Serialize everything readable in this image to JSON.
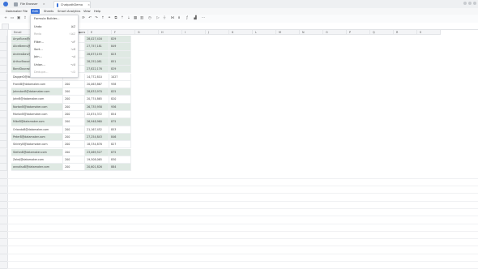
{
  "titlebar": {
    "tabs": [
      {
        "label": "File Browser"
      },
      {
        "label": "ChatpathDemo"
      }
    ]
  },
  "menubar": {
    "items": [
      "Datamaker",
      "File",
      "Edit",
      "Sheets",
      "Smart Analytics",
      "View",
      "Help"
    ],
    "active": "Edit"
  },
  "edit_menu": {
    "header": "Formula Builder...",
    "items": [
      {
        "label": "Undo",
        "shortcut": "⌘Z",
        "disabled": false
      },
      {
        "label": "Redo",
        "shortcut": "⇧⌘Z",
        "disabled": true
      },
      {
        "label": "Filter...",
        "shortcut": "⌥F",
        "disabled": false
      },
      {
        "label": "Sort...",
        "shortcut": "⌥S",
        "disabled": false
      },
      {
        "label": "Join...",
        "shortcut": "⌥J",
        "disabled": false
      },
      {
        "label": "Union...",
        "shortcut": "⌥U",
        "disabled": false
      },
      {
        "label": "Dedupe...",
        "shortcut": "⌥D",
        "disabled": true
      }
    ]
  },
  "grid": {
    "columns": [
      "Email",
      "",
      "Traffic",
      "Impressions",
      "E",
      "F",
      "G",
      "H",
      "I",
      "J",
      "K",
      "L",
      "M",
      "N",
      "O",
      "P",
      "Q",
      "R",
      "S"
    ],
    "rows": [
      {
        "email": "AnyaBuna@dat…",
        "b": "",
        "traffic": "28,027,416",
        "impr": "829",
        "hl": true
      },
      {
        "email": "AliceBeens@…",
        "b": "",
        "traffic": "27,757,181",
        "impr": "849",
        "hl": true
      },
      {
        "email": "AndreaDavi@…",
        "b": "",
        "traffic": "28,873,193",
        "impr": "823",
        "hl": true
      },
      {
        "email": "ArthurBraun@…",
        "b": "",
        "traffic": "28,252,081",
        "impr": "851",
        "hl": true
      },
      {
        "email": "BondDouras@…",
        "b": "",
        "traffic": "27,822,176",
        "impr": "829",
        "hl": true
      },
      {
        "email": "DaggerD@datamaker.com",
        "b": "200",
        "traffic": "14,772,810",
        "impr": "1027",
        "hl": false
      },
      {
        "email": "FrankB@datamaker.com",
        "b": "200",
        "traffic": "20,063,867",
        "impr": "938",
        "hl": false
      },
      {
        "email": "JohnstonB@datamaker.com",
        "b": "200",
        "traffic": "28,833,970",
        "impr": "825",
        "hl": true
      },
      {
        "email": "JohnB@datamaker.com",
        "b": "200",
        "traffic": "20,774,865",
        "impr": "820",
        "hl": false
      },
      {
        "email": "NortonB@datamaker.com",
        "b": "200",
        "traffic": "26,735,958",
        "impr": "936",
        "hl": true
      },
      {
        "email": "MarlonB@datamaker.com",
        "b": "200",
        "traffic": "22,874,372",
        "impr": "854",
        "hl": false
      },
      {
        "email": "MikeB@datamaker.com",
        "b": "200",
        "traffic": "26,948,960",
        "impr": "875",
        "hl": true
      },
      {
        "email": "OrlandoB@datamaker.com",
        "b": "200",
        "traffic": "21,167,452",
        "impr": "853",
        "hl": false
      },
      {
        "email": "PeterB@datamaker.com",
        "b": "200",
        "traffic": "27,254,843",
        "impr": "846",
        "hl": true
      },
      {
        "email": "ShirleyB@datamaker.com",
        "b": "200",
        "traffic": "18,334,876",
        "impr": "827",
        "hl": false
      },
      {
        "email": "StefanB@datamaker.com",
        "b": "200",
        "traffic": "23,069,527",
        "impr": "875",
        "hl": true
      },
      {
        "email": "ZakeJ@datamaker.com",
        "b": "200",
        "traffic": "19,508,065",
        "impr": "830",
        "hl": false
      },
      {
        "email": "annalisaB@datamaker.com",
        "b": "200",
        "traffic": "20,601,826",
        "impr": "884",
        "hl": true
      }
    ]
  },
  "colors": {
    "accent": "#3b73d9",
    "highlight": "#dfe9e3"
  }
}
